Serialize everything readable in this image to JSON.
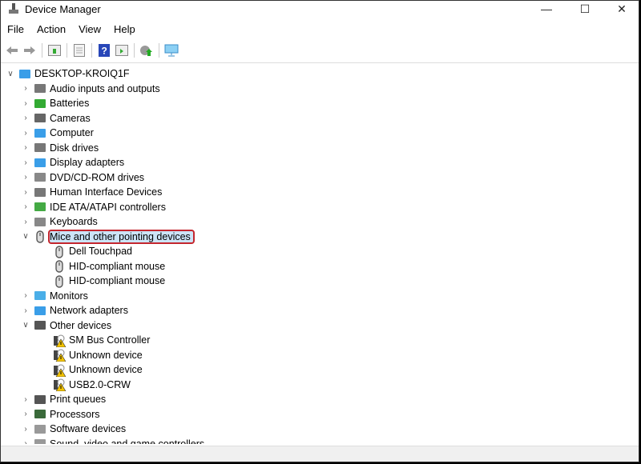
{
  "window": {
    "title": "Device Manager",
    "minimize": "—",
    "maximize": "☐",
    "close": "✕"
  },
  "menu": [
    "File",
    "Action",
    "View",
    "Help"
  ],
  "toolbar": [
    "back-icon",
    "forward-icon",
    "properties-icon",
    "update-icon",
    "help-icon",
    "run-icon",
    "scan-icon",
    "monitor-icon"
  ],
  "tree": {
    "root": "DESKTOP-KROIQ1F",
    "items": [
      {
        "label": "Audio inputs and outputs",
        "icon": "speaker-icon",
        "expanded": false
      },
      {
        "label": "Batteries",
        "icon": "battery-icon",
        "expanded": false
      },
      {
        "label": "Cameras",
        "icon": "camera-icon",
        "expanded": false
      },
      {
        "label": "Computer",
        "icon": "computer-icon",
        "expanded": false
      },
      {
        "label": "Disk drives",
        "icon": "disk-icon",
        "expanded": false
      },
      {
        "label": "Display adapters",
        "icon": "display-adapter-icon",
        "expanded": false
      },
      {
        "label": "DVD/CD-ROM drives",
        "icon": "dvd-icon",
        "expanded": false
      },
      {
        "label": "Human Interface Devices",
        "icon": "hid-icon",
        "expanded": false
      },
      {
        "label": "IDE ATA/ATAPI controllers",
        "icon": "ide-icon",
        "expanded": false
      },
      {
        "label": "Keyboards",
        "icon": "keyboard-icon",
        "expanded": false
      },
      {
        "label": "Mice and other pointing devices",
        "icon": "mouse-icon",
        "expanded": true,
        "selected": true,
        "children": [
          "Dell Touchpad",
          "HID-compliant mouse",
          "HID-compliant mouse"
        ]
      },
      {
        "label": "Monitors",
        "icon": "monitor-icon",
        "expanded": false
      },
      {
        "label": "Network adapters",
        "icon": "network-icon",
        "expanded": false
      },
      {
        "label": "Other devices",
        "icon": "unknown-icon",
        "expanded": true,
        "children": [
          "SM Bus Controller",
          "Unknown device",
          "Unknown device",
          "USB2.0-CRW"
        ]
      },
      {
        "label": "Print queues",
        "icon": "printer-icon",
        "expanded": false
      },
      {
        "label": "Processors",
        "icon": "processor-icon",
        "expanded": false
      },
      {
        "label": "Software devices",
        "icon": "software-icon",
        "expanded": false
      },
      {
        "label": "Sound, video and game controllers",
        "icon": "sound-icon",
        "expanded": false
      }
    ]
  },
  "colors": {
    "selection": "#cce4f7",
    "highlight_border": "#c4262e"
  }
}
